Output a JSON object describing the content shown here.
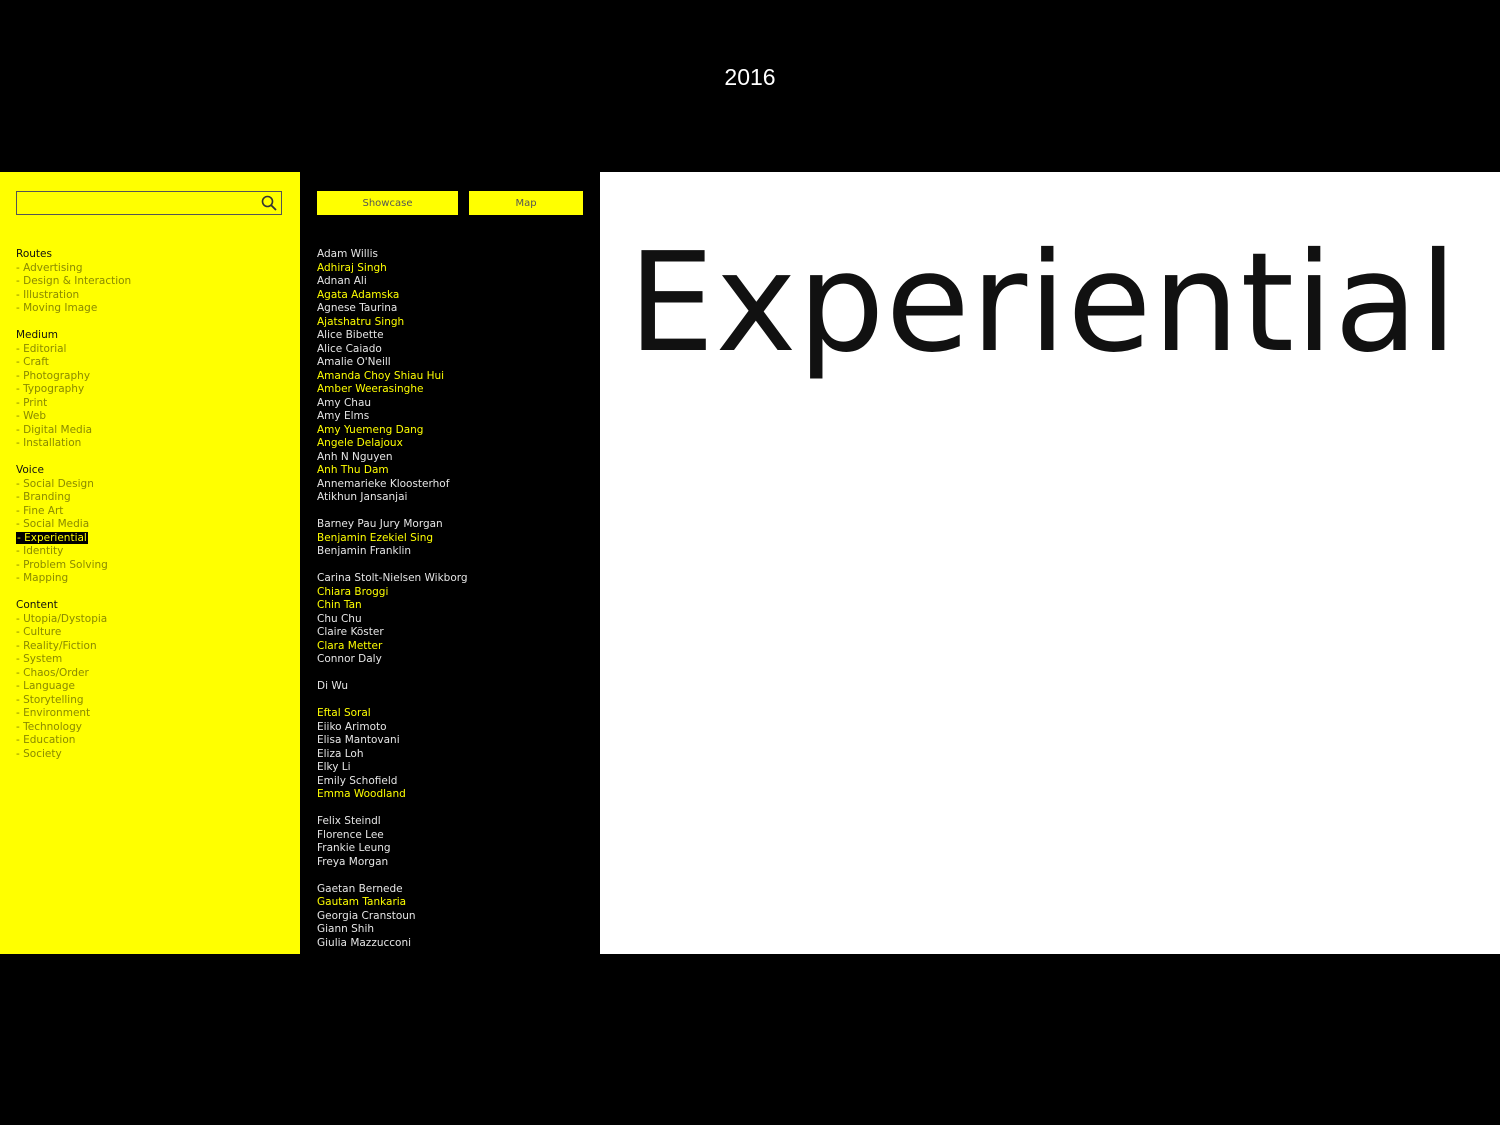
{
  "year": "2016",
  "search": {
    "value": "",
    "placeholder": ""
  },
  "nav": {
    "showcase_label": "Showcase",
    "map_label": "Map"
  },
  "filters": [
    {
      "title": "Routes",
      "items": [
        {
          "label": "- Advertising"
        },
        {
          "label": "- Design & Interaction"
        },
        {
          "label": "- Illustration"
        },
        {
          "label": "- Moving Image"
        }
      ]
    },
    {
      "title": "Medium",
      "items": [
        {
          "label": "- Editorial"
        },
        {
          "label": "- Craft"
        },
        {
          "label": "- Photography"
        },
        {
          "label": "- Typography"
        },
        {
          "label": "- Print"
        },
        {
          "label": "- Web"
        },
        {
          "label": "- Digital Media"
        },
        {
          "label": "- Installation"
        }
      ]
    },
    {
      "title": "Voice",
      "items": [
        {
          "label": "- Social Design"
        },
        {
          "label": "- Branding"
        },
        {
          "label": "- Fine Art"
        },
        {
          "label": "- Social Media"
        },
        {
          "label": "- Experiential",
          "active": true
        },
        {
          "label": "- Identity"
        },
        {
          "label": "- Problem Solving"
        },
        {
          "label": "- Mapping"
        }
      ]
    },
    {
      "title": "Content",
      "items": [
        {
          "label": "- Utopia/Dystopia"
        },
        {
          "label": "- Culture"
        },
        {
          "label": "- Reality/Fiction"
        },
        {
          "label": "- System"
        },
        {
          "label": "- Chaos/Order"
        },
        {
          "label": "- Language"
        },
        {
          "label": "- Storytelling"
        },
        {
          "label": "- Environment"
        },
        {
          "label": "- Technology"
        },
        {
          "label": "- Education"
        },
        {
          "label": "- Society"
        }
      ]
    }
  ],
  "name_groups": [
    [
      {
        "name": "Adam Willis"
      },
      {
        "name": "Adhiraj Singh",
        "highlighted": true
      },
      {
        "name": "Adnan Ali"
      },
      {
        "name": "Agata Adamska",
        "highlighted": true
      },
      {
        "name": "Agnese Taurina"
      },
      {
        "name": "Ajatshatru Singh",
        "highlighted": true
      },
      {
        "name": "Alice Bibette"
      },
      {
        "name": "Alice Caiado"
      },
      {
        "name": "Amalie O'Neill"
      },
      {
        "name": "Amanda Choy Shiau Hui",
        "highlighted": true
      },
      {
        "name": "Amber Weerasinghe",
        "highlighted": true
      },
      {
        "name": "Amy Chau"
      },
      {
        "name": "Amy Elms"
      },
      {
        "name": "Amy Yuemeng Dang",
        "highlighted": true
      },
      {
        "name": "Angele Delajoux",
        "highlighted": true
      },
      {
        "name": "Anh N Nguyen"
      },
      {
        "name": "Anh Thu Dam",
        "highlighted": true
      },
      {
        "name": "Annemarieke Kloosterhof"
      },
      {
        "name": "Atikhun Jansanjai"
      }
    ],
    [
      {
        "name": "Barney Pau Jury Morgan"
      },
      {
        "name": "Benjamin Ezekiel Sing",
        "highlighted": true
      },
      {
        "name": "Benjamin Franklin"
      }
    ],
    [
      {
        "name": "Carina Stolt-Nielsen Wikborg"
      },
      {
        "name": "Chiara Broggi",
        "highlighted": true
      },
      {
        "name": "Chin Tan",
        "highlighted": true
      },
      {
        "name": "Chu Chu"
      },
      {
        "name": "Claire Köster"
      },
      {
        "name": "Clara Metter",
        "highlighted": true
      },
      {
        "name": "Connor Daly"
      }
    ],
    [
      {
        "name": "Di Wu"
      }
    ],
    [
      {
        "name": "Eftal Soral",
        "highlighted": true
      },
      {
        "name": "Eiiko Arimoto"
      },
      {
        "name": "Elisa Mantovani"
      },
      {
        "name": "Eliza Loh"
      },
      {
        "name": "Elky Li"
      },
      {
        "name": "Emily Schofield"
      },
      {
        "name": "Emma Woodland",
        "highlighted": true
      }
    ],
    [
      {
        "name": "Felix Steindl"
      },
      {
        "name": "Florence Lee"
      },
      {
        "name": "Frankie Leung"
      },
      {
        "name": "Freya Morgan"
      }
    ],
    [
      {
        "name": "Gaetan Bernede"
      },
      {
        "name": "Gautam Tankaria",
        "highlighted": true
      },
      {
        "name": "Georgia Cranstoun"
      },
      {
        "name": "Giann Shih"
      },
      {
        "name": "Giulia Mazzucconi"
      }
    ]
  ],
  "content": {
    "title": "Experiential"
  },
  "colors": {
    "accent": "#ffff00",
    "background": "#000000",
    "panel": "#ffffff"
  }
}
